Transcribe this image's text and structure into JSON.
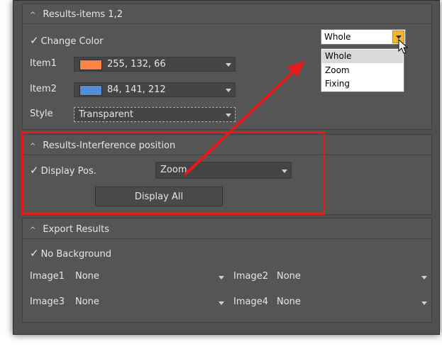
{
  "results_items": {
    "header": "Results-items 1,2",
    "change_color_label": "Change Color",
    "item1_label": "Item1",
    "item1_value": "255, 132, 66",
    "item1_color": "#ff8442",
    "item2_label": "Item2",
    "item2_value": "84, 141, 212",
    "item2_color": "#548dd4",
    "style_label": "Style",
    "style_value": "Transparent",
    "mode_value": "Whole",
    "mode_options": [
      "Whole",
      "Zoom",
      "Fixing"
    ]
  },
  "interference": {
    "header": "Results-Interference position",
    "display_pos_label": "Display Pos.",
    "display_pos_value": "Zoom",
    "display_all_label": "Display All"
  },
  "export": {
    "header": "Export Results",
    "no_background_label": "No Background",
    "image1_label": "Image1",
    "image1_value": "None",
    "image2_label": "Image2",
    "image2_value": "None",
    "image3_label": "Image3",
    "image3_value": "None",
    "image4_label": "Image4",
    "image4_value": "None"
  },
  "annotation": {
    "highlight_color": "#e31b1b"
  }
}
